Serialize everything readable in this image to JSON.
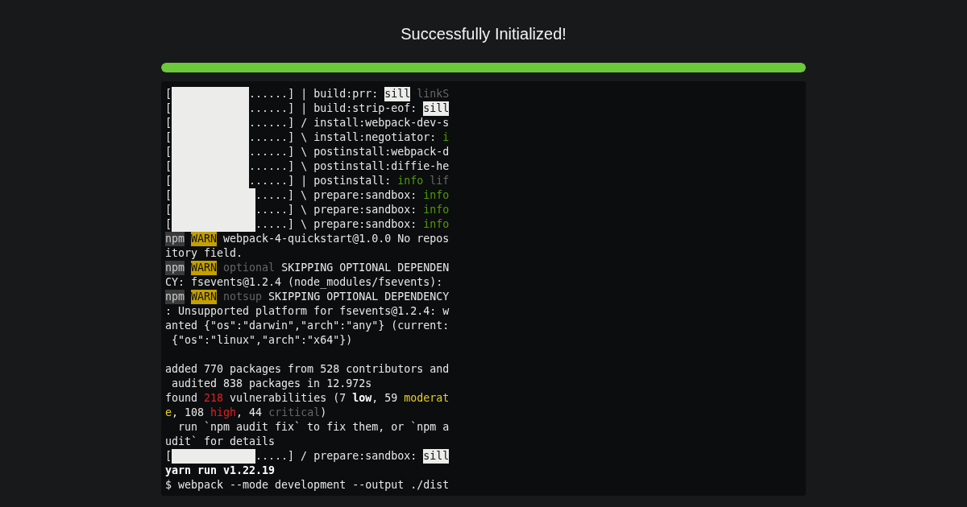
{
  "title": "Successfully Initialized!",
  "progress": {
    "level": 1
  },
  "terminal": {
    "lines": [
      [
        {
          "kind": "plain",
          "text": "["
        },
        {
          "kind": "cover",
          "text": "......"
        },
        {
          "kind": "plain",
          "text": "] | build:prr: "
        },
        {
          "kind": "inverse",
          "text": "sill"
        },
        {
          "kind": "dim",
          "text": " linkS"
        }
      ],
      [
        {
          "kind": "plain",
          "text": "["
        },
        {
          "kind": "cover",
          "text": "......"
        },
        {
          "kind": "plain",
          "text": "] | build:strip-eof: "
        },
        {
          "kind": "inverse",
          "text": "sill"
        }
      ],
      [
        {
          "kind": "plain",
          "text": "["
        },
        {
          "kind": "cover",
          "text": "......"
        },
        {
          "kind": "plain",
          "text": "] / install:webpack-dev-s"
        }
      ],
      [
        {
          "kind": "plain",
          "text": "["
        },
        {
          "kind": "cover",
          "text": "......"
        },
        {
          "kind": "plain",
          "text": "] \\ install:negotiator: "
        },
        {
          "kind": "green",
          "text": "i"
        }
      ],
      [
        {
          "kind": "plain",
          "text": "["
        },
        {
          "kind": "cover",
          "text": "......"
        },
        {
          "kind": "plain",
          "text": "] \\ postinstall:webpack-d"
        }
      ],
      [
        {
          "kind": "plain",
          "text": "["
        },
        {
          "kind": "cover",
          "text": "......"
        },
        {
          "kind": "plain",
          "text": "] \\ postinstall:diffie-he"
        }
      ],
      [
        {
          "kind": "plain",
          "text": "["
        },
        {
          "kind": "cover",
          "text": "......"
        },
        {
          "kind": "plain",
          "text": "] | postinstall: "
        },
        {
          "kind": "green",
          "text": "info"
        },
        {
          "kind": "dim",
          "text": " lif"
        }
      ],
      [
        {
          "kind": "plain",
          "text": "["
        },
        {
          "kind": "cover",
          "text": "....."
        },
        {
          "kind": "plain",
          "text": "] \\ prepare:sandbox: "
        },
        {
          "kind": "green",
          "text": "info"
        }
      ],
      [
        {
          "kind": "plain",
          "text": "["
        },
        {
          "kind": "cover",
          "text": "....."
        },
        {
          "kind": "plain",
          "text": "] \\ prepare:sandbox: "
        },
        {
          "kind": "green",
          "text": "info"
        }
      ],
      [
        {
          "kind": "plain",
          "text": "["
        },
        {
          "kind": "cover",
          "text": "....."
        },
        {
          "kind": "plain",
          "text": "] \\ prepare:sandbox: "
        },
        {
          "kind": "green",
          "text": "info"
        }
      ],
      [
        {
          "kind": "npm",
          "text": "npm"
        },
        {
          "kind": "warn",
          "text": "WARN"
        },
        {
          "kind": "plain",
          "text": " webpack-4-quickstart@1.0.0 No repos"
        }
      ],
      [
        {
          "kind": "plain",
          "text": "itory field."
        }
      ],
      [
        {
          "kind": "npm",
          "text": "npm"
        },
        {
          "kind": "warn",
          "text": "WARN"
        },
        {
          "kind": "dim",
          "text": " optional"
        },
        {
          "kind": "plain",
          "text": " SKIPPING OPTIONAL DEPENDEN"
        }
      ],
      [
        {
          "kind": "plain",
          "text": "CY: fsevents@1.2.4 (node_modules/fsevents):"
        }
      ],
      [
        {
          "kind": "npm",
          "text": "npm"
        },
        {
          "kind": "warn",
          "text": "WARN"
        },
        {
          "kind": "dim",
          "text": " notsup"
        },
        {
          "kind": "plain",
          "text": " SKIPPING OPTIONAL DEPENDENCY"
        }
      ],
      [
        {
          "kind": "plain",
          "text": ": Unsupported platform for fsevents@1.2.4: w"
        }
      ],
      [
        {
          "kind": "plain",
          "text": "anted {\"os\":\"darwin\",\"arch\":\"any\"} (current:"
        }
      ],
      [
        {
          "kind": "plain",
          "text": " {\"os\":\"linux\",\"arch\":\"x64\"})"
        }
      ],
      [
        {
          "kind": "blank"
        }
      ],
      [
        {
          "kind": "plain",
          "text": "added 770 packages from 528 contributors and"
        }
      ],
      [
        {
          "kind": "plain",
          "text": " audited 838 packages in 12.972s"
        }
      ],
      [
        {
          "kind": "plain",
          "text": "found "
        },
        {
          "kind": "red",
          "text": "218"
        },
        {
          "kind": "plain",
          "text": " vulnerabilities (7 "
        },
        {
          "kind": "bold",
          "text": "low"
        },
        {
          "kind": "plain",
          "text": ", 59 "
        },
        {
          "kind": "yellow",
          "text": "moderat"
        }
      ],
      [
        {
          "kind": "yellow",
          "text": "e"
        },
        {
          "kind": "plain",
          "text": ", 108 "
        },
        {
          "kind": "red",
          "text": "high"
        },
        {
          "kind": "plain",
          "text": ", 44 "
        },
        {
          "kind": "dim",
          "text": "critical"
        },
        {
          "kind": "plain",
          "text": ")"
        }
      ],
      [
        {
          "kind": "plain",
          "text": "  run `npm audit fix` to fix them, or `npm a"
        }
      ],
      [
        {
          "kind": "plain",
          "text": "udit` for details"
        }
      ],
      [
        {
          "kind": "plain",
          "text": "["
        },
        {
          "kind": "cover",
          "text": "....."
        },
        {
          "kind": "plain",
          "text": "] / prepare:sandbox: "
        },
        {
          "kind": "inverse",
          "text": "sill"
        }
      ],
      [
        {
          "kind": "bold",
          "text": "yarn run v1.22.19"
        }
      ],
      [
        {
          "kind": "plain",
          "text": "$ webpack --mode development --output ./dist"
        }
      ]
    ]
  }
}
